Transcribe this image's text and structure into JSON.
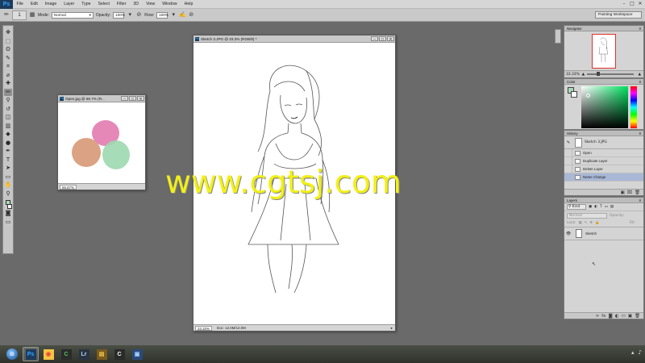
{
  "app": {
    "logo": "Ps",
    "menu": [
      "File",
      "Edit",
      "Image",
      "Layer",
      "Type",
      "Select",
      "Filter",
      "3D",
      "View",
      "Window",
      "Help"
    ],
    "window_controls": [
      "–",
      "□",
      "✕"
    ]
  },
  "options_bar": {
    "brush_size": "1",
    "mode_label": "Mode:",
    "mode_value": "Normal",
    "opacity_label": "Opacity:",
    "opacity_value": "100%",
    "flow_label": "Flow:",
    "flow_value": "100%",
    "workspace": "Painting Workspace"
  },
  "toolbox": {
    "tools": [
      {
        "name": "move-tool",
        "glyph": "✥"
      },
      {
        "name": "marquee-tool",
        "glyph": "⬚"
      },
      {
        "name": "lasso-tool",
        "glyph": "ʘ"
      },
      {
        "name": "quick-select-tool",
        "glyph": "✎"
      },
      {
        "name": "crop-tool",
        "glyph": "⌗"
      },
      {
        "name": "eyedropper-tool",
        "glyph": "⌀"
      },
      {
        "name": "healing-tool",
        "glyph": "✚"
      },
      {
        "name": "brush-tool",
        "glyph": "✏",
        "active": true
      },
      {
        "name": "clone-stamp-tool",
        "glyph": "⚲"
      },
      {
        "name": "history-brush-tool",
        "glyph": "↺"
      },
      {
        "name": "eraser-tool",
        "glyph": "◫"
      },
      {
        "name": "gradient-tool",
        "glyph": "▥"
      },
      {
        "name": "blur-tool",
        "glyph": "◆"
      },
      {
        "name": "dodge-tool",
        "glyph": "●"
      },
      {
        "name": "pen-tool",
        "glyph": "✒"
      },
      {
        "name": "type-tool",
        "glyph": "T"
      },
      {
        "name": "path-select-tool",
        "glyph": "➤"
      },
      {
        "name": "shape-tool",
        "glyph": "▭"
      },
      {
        "name": "hand-tool",
        "glyph": "✋"
      },
      {
        "name": "zoom-tool",
        "glyph": "⚲"
      }
    ],
    "foreground_color": "#a8d8b8",
    "background_color": "#ffffff"
  },
  "open_doc": {
    "title": "Open.jpg @ 66.7% (R...",
    "zoom": "66.67%",
    "blobs": [
      {
        "color": "#e27bb0"
      },
      {
        "color": "#d99a7a"
      },
      {
        "color": "#9dd8b0"
      }
    ]
  },
  "sketch_doc": {
    "title": "Sketch 3.JPG @ 33.3% (RGB/8) *",
    "zoom": "33.33%",
    "doc_info": "Doc: 12.0M/12.0M"
  },
  "navigator": {
    "tab": "Navigator",
    "zoom": "33.33%"
  },
  "color_panel": {
    "tab": "Color",
    "hue_color": "#00e060"
  },
  "history": {
    "tab": "History",
    "snapshot": "Sketch 3.JPG",
    "items": [
      "Open",
      "Duplicate Layer",
      "Delete Layer",
      "Name Change"
    ],
    "selected_index": 3
  },
  "layers": {
    "tab": "Layers",
    "filter_kind": "Kind",
    "blend_mode": "Normal",
    "opacity_label": "Opacity:",
    "lock_label": "Lock:",
    "fill_label": "Fill:",
    "items": [
      {
        "name": "Sketch",
        "visible": true
      }
    ]
  },
  "taskbar": {
    "apps": [
      {
        "name": "photoshop",
        "label": "Ps",
        "color": "#31a8ff",
        "bg": "#1c3b5e",
        "active": true
      },
      {
        "name": "chrome",
        "label": "◉",
        "color": "#e8453c",
        "bg": "#f6c343"
      },
      {
        "name": "camtasia",
        "label": "C",
        "color": "#5ac85a",
        "bg": "#2b2b2b"
      },
      {
        "name": "lightroom",
        "label": "Lr",
        "color": "#b6d3f2",
        "bg": "#2a3342"
      },
      {
        "name": "explorer",
        "label": "▤",
        "color": "#f2c94c",
        "bg": "#7a5a1e"
      },
      {
        "name": "camtasia-recorder",
        "label": "C",
        "color": "#ffffff",
        "bg": "#2a2a2a"
      },
      {
        "name": "media-player",
        "label": "▣",
        "color": "#a6d0ff",
        "bg": "#2b4a7a"
      }
    ]
  },
  "watermark": "www.cgtsj.com"
}
